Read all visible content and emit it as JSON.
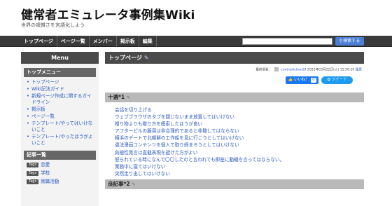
{
  "site": {
    "title": "健常者エミュレータ事例集Wiki",
    "tagline": "世界の複雑さを言語化しよう"
  },
  "nav": {
    "items": [
      "トップページ",
      "ページ一覧",
      "メンバー",
      "掲示板",
      "編集"
    ],
    "search_placeholder": "",
    "search_button": "検索する",
    "search_icon": "search-icon"
  },
  "sidebar": {
    "header": "Menu",
    "top_menu_title": "トップメニュー",
    "top_menu_items": [
      "トップページ",
      "Wiki記法ガイド",
      "新規ページ作成に関するガイドライン",
      "掲示板",
      "ページ一覧",
      "テンプレート/やってはいけないこと",
      "テンプレート/やったほうがよいこと"
    ],
    "articles_title": "記事一覧",
    "tag_label": "Tags",
    "articles": [
      "恋愛",
      "学校",
      "就職活動"
    ]
  },
  "main": {
    "page_title": "トップページ",
    "meta": {
      "prefix": "最終更新：",
      "user": "contradiction29",
      "datetime": "2022年03月22日(火) 15:50:20",
      "history": "履歴"
    },
    "like_label": "いいね！",
    "like_count": "0",
    "tweet_label": "ツイート",
    "section1_title": "十選*1",
    "section1_items": [
      "会話を切り上げる",
      "ウェブブラウザのタブを閉じないまま放置してはいけない",
      "贈り物よりも贈り方を模索したほうが良い",
      "アフターピルの服用は非合理的であると非難してはならない",
      "横浜のデートで北朝鮮の工作船を見に行こうとしてはいけない",
      "違法漫画コンテンツを個人で取り締まろうとしてはいけない",
      "負極性発言は直截表現を避けた方がよい",
      "怒られている時になんで〇〇したのと言われても即座に動機を言ってはならない。",
      "業務中に寝てはいけない",
      "突然走り出してはいけない"
    ],
    "section2_title": "良記事*2"
  }
}
